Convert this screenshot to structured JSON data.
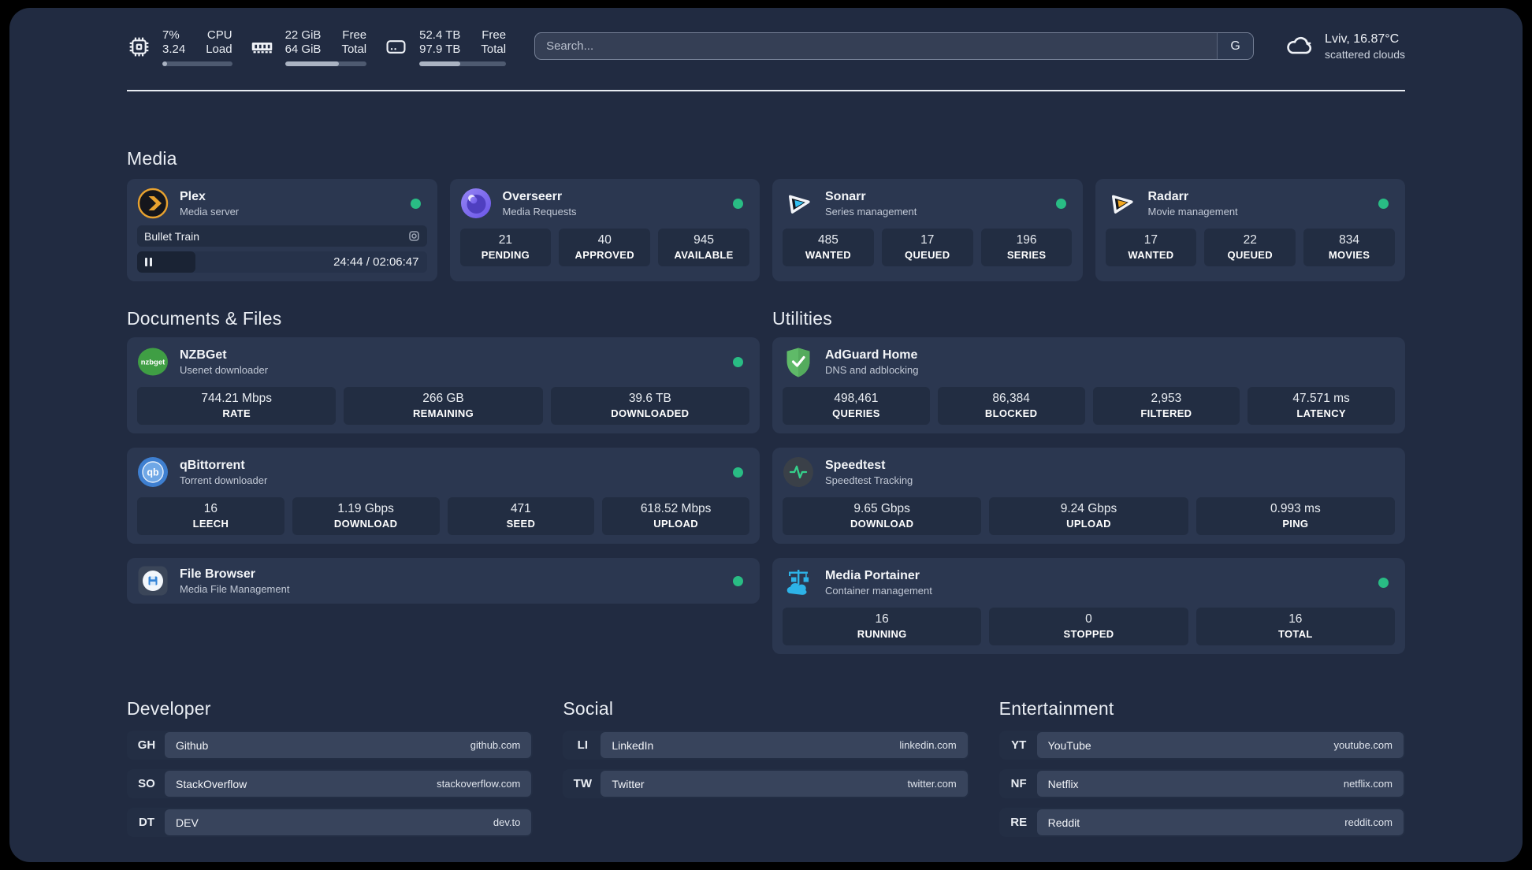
{
  "topbar": {
    "cpu": {
      "value_top": "7%",
      "value_bottom": "3.24",
      "label_top": "CPU",
      "label_bottom": "Load",
      "progress": 7
    },
    "memory": {
      "value_top": "22 GiB",
      "value_bottom": "64 GiB",
      "label_top": "Free",
      "label_bottom": "Total",
      "progress": 66
    },
    "disk": {
      "value_top": "52.4 TB",
      "value_bottom": "97.9 TB",
      "label_top": "Free",
      "label_bottom": "Total",
      "progress": 47
    },
    "search": {
      "placeholder": "Search...",
      "button_label": "G"
    },
    "weather": {
      "location_temp": "Lviv, 16.87°C",
      "condition": "scattered clouds"
    }
  },
  "media": {
    "title": "Media",
    "plex": {
      "name": "Plex",
      "subtitle": "Media server",
      "now_playing": "Bullet Train",
      "time": "24:44 / 02:06:47",
      "progress": 20
    },
    "overseerr": {
      "name": "Overseerr",
      "subtitle": "Media Requests",
      "stats": [
        {
          "value": "21",
          "label": "PENDING"
        },
        {
          "value": "40",
          "label": "APPROVED"
        },
        {
          "value": "945",
          "label": "AVAILABLE"
        }
      ]
    },
    "sonarr": {
      "name": "Sonarr",
      "subtitle": "Series management",
      "stats": [
        {
          "value": "485",
          "label": "WANTED"
        },
        {
          "value": "17",
          "label": "QUEUED"
        },
        {
          "value": "196",
          "label": "SERIES"
        }
      ]
    },
    "radarr": {
      "name": "Radarr",
      "subtitle": "Movie management",
      "stats": [
        {
          "value": "17",
          "label": "WANTED"
        },
        {
          "value": "22",
          "label": "QUEUED"
        },
        {
          "value": "834",
          "label": "MOVIES"
        }
      ]
    }
  },
  "documents": {
    "title": "Documents & Files",
    "nzbget": {
      "name": "NZBGet",
      "subtitle": "Usenet downloader",
      "stats": [
        {
          "value": "744.21 Mbps",
          "label": "RATE"
        },
        {
          "value": "266 GB",
          "label": "REMAINING"
        },
        {
          "value": "39.6 TB",
          "label": "DOWNLOADED"
        }
      ]
    },
    "qbittorrent": {
      "name": "qBittorrent",
      "subtitle": "Torrent downloader",
      "stats": [
        {
          "value": "16",
          "label": "LEECH"
        },
        {
          "value": "1.19 Gbps",
          "label": "DOWNLOAD"
        },
        {
          "value": "471",
          "label": "SEED"
        },
        {
          "value": "618.52 Mbps",
          "label": "UPLOAD"
        }
      ]
    },
    "filebrowser": {
      "name": "File Browser",
      "subtitle": "Media File Management"
    }
  },
  "utilities": {
    "title": "Utilities",
    "adguard": {
      "name": "AdGuard Home",
      "subtitle": "DNS and adblocking",
      "stats": [
        {
          "value": "498,461",
          "label": "QUERIES"
        },
        {
          "value": "86,384",
          "label": "BLOCKED"
        },
        {
          "value": "2,953",
          "label": "FILTERED"
        },
        {
          "value": "47.571 ms",
          "label": "LATENCY"
        }
      ]
    },
    "speedtest": {
      "name": "Speedtest",
      "subtitle": "Speedtest Tracking",
      "stats": [
        {
          "value": "9.65 Gbps",
          "label": "DOWNLOAD"
        },
        {
          "value": "9.24 Gbps",
          "label": "UPLOAD"
        },
        {
          "value": "0.993 ms",
          "label": "PING"
        }
      ]
    },
    "portainer": {
      "name": "Media Portainer",
      "subtitle": "Container management",
      "stats": [
        {
          "value": "16",
          "label": "RUNNING"
        },
        {
          "value": "0",
          "label": "STOPPED"
        },
        {
          "value": "16",
          "label": "TOTAL"
        }
      ]
    }
  },
  "bookmarks": {
    "developer": {
      "title": "Developer",
      "items": [
        {
          "abbr": "GH",
          "name": "Github",
          "url": "github.com"
        },
        {
          "abbr": "SO",
          "name": "StackOverflow",
          "url": "stackoverflow.com"
        },
        {
          "abbr": "DT",
          "name": "DEV",
          "url": "dev.to"
        }
      ]
    },
    "social": {
      "title": "Social",
      "items": [
        {
          "abbr": "LI",
          "name": "LinkedIn",
          "url": "linkedin.com"
        },
        {
          "abbr": "TW",
          "name": "Twitter",
          "url": "twitter.com"
        }
      ]
    },
    "entertainment": {
      "title": "Entertainment",
      "items": [
        {
          "abbr": "YT",
          "name": "YouTube",
          "url": "youtube.com"
        },
        {
          "abbr": "NF",
          "name": "Netflix",
          "url": "netflix.com"
        },
        {
          "abbr": "RE",
          "name": "Reddit",
          "url": "reddit.com"
        }
      ]
    }
  }
}
